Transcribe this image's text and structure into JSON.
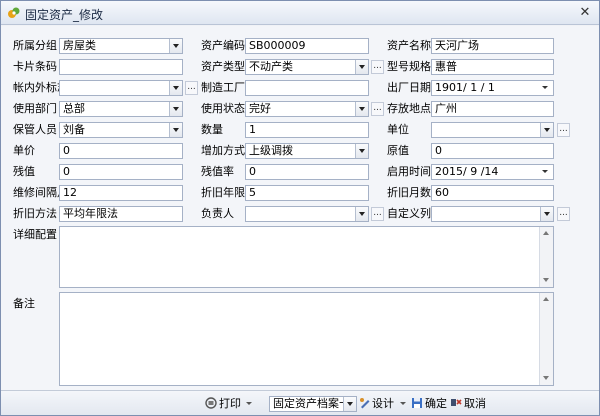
{
  "window": {
    "title": "固定资产_修改"
  },
  "form": {
    "group_label": "所属分组",
    "group_value": "房屋类",
    "code_label": "资产编码",
    "code_value": "SB000009",
    "name_label": "资产名称",
    "name_value": "天河广场",
    "card_label": "卡片条码",
    "card_value": "",
    "type_label": "资产类型",
    "type_value": "不动产类",
    "model_label": "型号规格",
    "model_value": "惠普",
    "account_label": "帐内外标志",
    "account_value": "",
    "maker_label": "制造工厂",
    "maker_value": "",
    "date_label": "出厂日期",
    "date_value": "1901/ 1 / 1",
    "dept_label": "使用部门",
    "dept_value": "总部",
    "status_label": "使用状态",
    "status_value": "完好",
    "location_label": "存放地点",
    "location_value": "广州",
    "keeper_label": "保管人员",
    "keeper_value": "刘备",
    "qty_label": "数量",
    "qty_value": "1",
    "unit_label": "单位",
    "unit_value": "",
    "price_label": "单价",
    "price_value": "0",
    "add_label": "增加方式",
    "add_value": "上级调拨",
    "orig_label": "原值",
    "orig_value": "0",
    "residual_label": "残值",
    "residual_value": "0",
    "residual_rate_label": "残值率",
    "residual_rate_value": "0",
    "start_label": "启用时间",
    "start_value": "2015/ 9 /14",
    "maint_label": "维修间隔月",
    "maint_value": "12",
    "years_label": "折旧年限",
    "years_value": "5",
    "months_label": "折旧月数",
    "months_value": "60",
    "method_label": "折旧方法",
    "method_value": "平均年限法",
    "owner_label": "负责人",
    "owner_value": "",
    "custom_label": "自定义列1",
    "custom_value": "",
    "detail_label": "详细配置",
    "detail_value": "",
    "remark_label": "备注",
    "remark_value": ""
  },
  "toolbar": {
    "print_label": "打印",
    "template_value": "固定资产档案卡",
    "design_label": "设计",
    "confirm_label": "确定",
    "cancel_label": "取消"
  },
  "colors": {
    "accent": "#3a6fc4",
    "border": "#a5b1c6",
    "title_bg": "#dfe6f1"
  }
}
